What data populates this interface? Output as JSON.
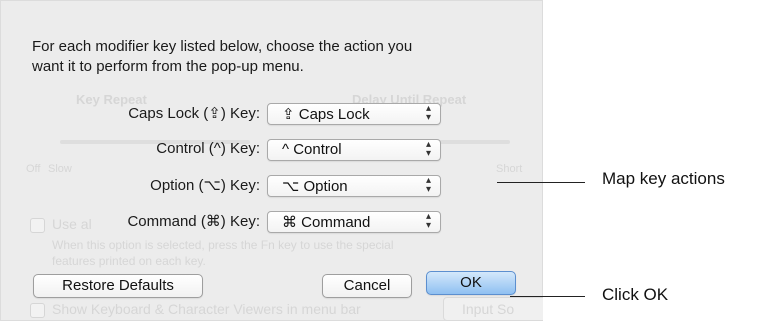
{
  "dialog": {
    "intro_line1": "For each modifier key listed below, choose the action you",
    "intro_line2": "want it to perform from the pop-up menu.",
    "rows": [
      {
        "label": "Caps Lock (⇪) Key:",
        "value": "⇪ Caps Lock"
      },
      {
        "label": "Control (^) Key:",
        "value": "^ Control"
      },
      {
        "label": "Option (⌥) Key:",
        "value": "⌥ Option"
      },
      {
        "label": "Command (⌘) Key:",
        "value": "⌘ Command"
      }
    ],
    "restore_defaults_label": "Restore Defaults",
    "cancel_label": "Cancel",
    "ok_label": "OK"
  },
  "background": {
    "key_repeat": "Key Repeat",
    "delay_until_repeat": "Delay Until Repeat",
    "off": "Off",
    "slow": "Slow",
    "short": "Short",
    "use_all": "Use al",
    "hint_line1": "When this option is selected, press the Fn key to use the special",
    "hint_line2": "features printed on each key.",
    "show_viewers": "Show Keyboard & Character Viewers in menu bar",
    "input_sources": "Input So"
  },
  "annotations": {
    "map_key_actions": "Map key actions",
    "click_ok": "Click OK"
  },
  "colors": {
    "sheet_bg": "#ececec",
    "default_button": "#8fc0f1",
    "callout": "#222222"
  },
  "icons": {
    "popup_arrows": "up-down-chevron-icon"
  }
}
